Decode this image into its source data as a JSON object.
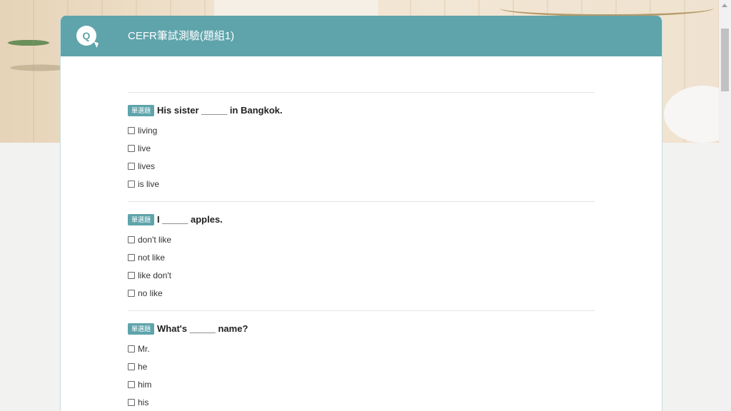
{
  "header": {
    "badge": "Q",
    "title": "CEFR筆試測驗(題組1)"
  },
  "questions": [
    {
      "tag": "單選題",
      "text": "His sister _____ in Bangkok.",
      "options": [
        "living",
        "live",
        "lives",
        "is live"
      ]
    },
    {
      "tag": "單選題",
      "text": "I _____ apples.",
      "options": [
        "don't like",
        "not like",
        "like don't",
        "no like"
      ]
    },
    {
      "tag": "單選題",
      "text": "What's _____ name?",
      "options": [
        "Mr.",
        "he",
        "him",
        "his"
      ]
    }
  ],
  "colors": {
    "accent": "#5fa4ab"
  }
}
